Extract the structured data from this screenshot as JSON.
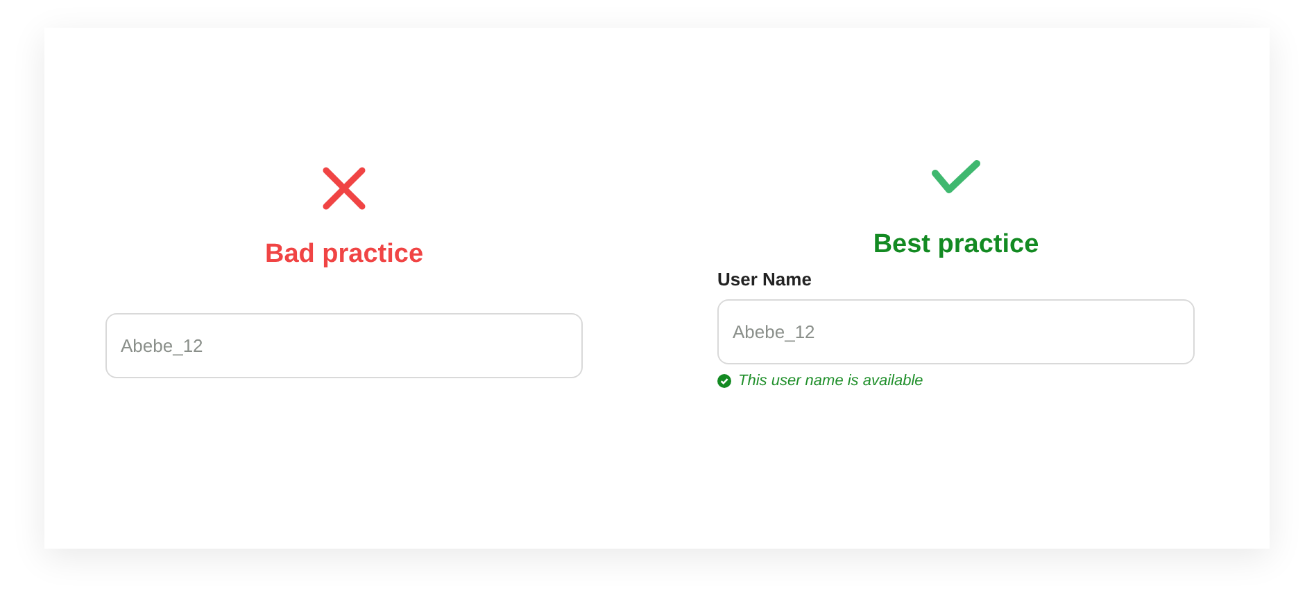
{
  "panels": [
    {
      "kind": "bad",
      "title": "Bad practice",
      "field": {
        "placeholder": "Abebe_12"
      }
    },
    {
      "kind": "good",
      "title": "Best practice",
      "field": {
        "label": "User Name",
        "placeholder": "Abebe_12",
        "hint": "This user name is available"
      }
    }
  ]
}
